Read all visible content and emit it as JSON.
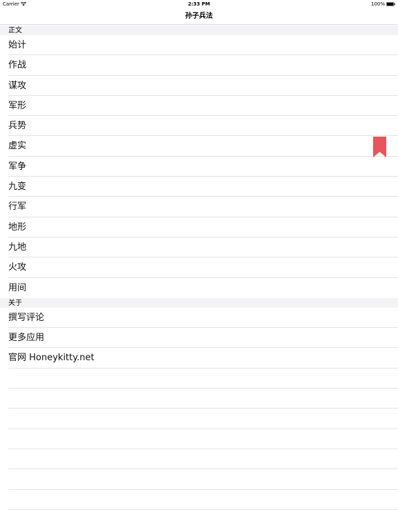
{
  "status_bar": {
    "carrier": "Carrier",
    "time": "2:33 PM",
    "battery": "100%",
    "wifi_icon": "wifi-icon",
    "battery_icon": "battery-full-icon"
  },
  "nav": {
    "title": "孙子兵法"
  },
  "sections": [
    {
      "header": "正文",
      "items": [
        "始计",
        "作战",
        "谋攻",
        "军形",
        "兵势",
        "虚实",
        "军争",
        "九变",
        "行军",
        "地形",
        "九地",
        "火攻",
        "用间"
      ]
    },
    {
      "header": "关于",
      "items": [
        "撰写评论",
        "更多应用",
        "官网 Honeykitty.net"
      ]
    }
  ],
  "bookmark": {
    "icon": "bookmark-icon",
    "color": "#e8555a"
  }
}
